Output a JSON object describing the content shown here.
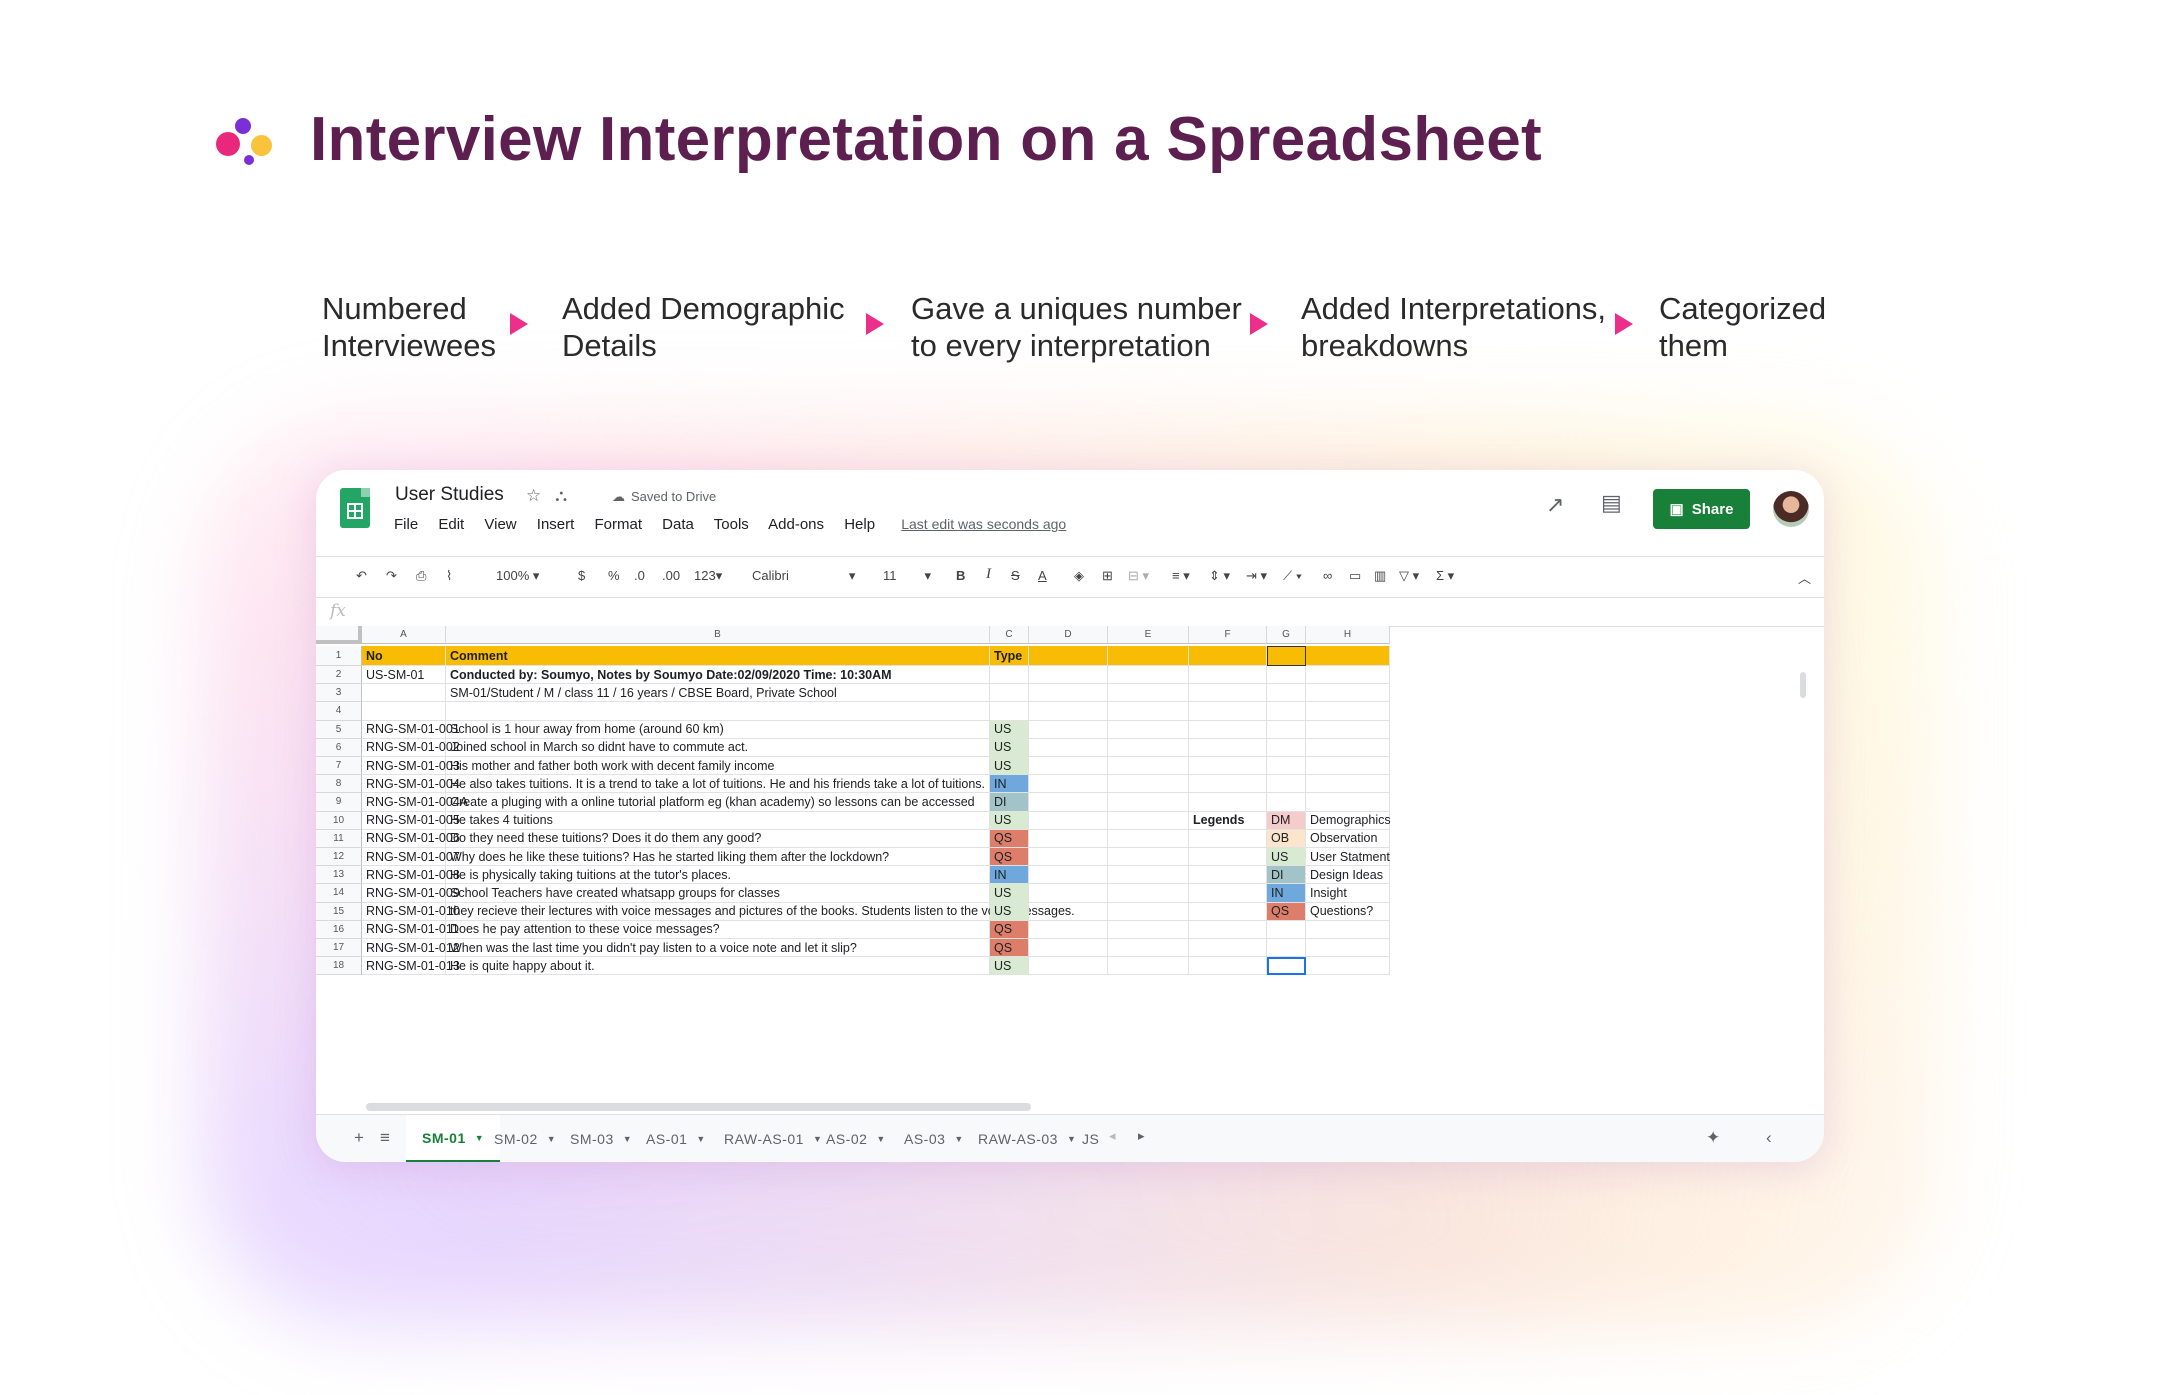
{
  "page": {
    "title": "Interview Interpretation on a Spreadsheet",
    "steps": [
      {
        "line1": "Numbered",
        "line2": "Interviewees"
      },
      {
        "line1": "Added Demographic",
        "line2": "Details"
      },
      {
        "line1": "Gave a uniques number",
        "line2": "to every interpretation"
      },
      {
        "line1": "Added Interpretations,",
        "line2": "breakdowns"
      },
      {
        "line1": "Categorized",
        "line2": "them"
      }
    ]
  },
  "app": {
    "doc_title": "User Studies",
    "saved_status": "Saved to Drive",
    "menus": [
      "File",
      "Edit",
      "View",
      "Insert",
      "Format",
      "Data",
      "Tools",
      "Add-ons",
      "Help"
    ],
    "last_edit": "Last edit was seconds ago",
    "share_label": "Share",
    "toolbar": {
      "zoom": "100%",
      "currency": "$",
      "percent": "%",
      "dec_less": ".0",
      "dec_more": ".00",
      "format_num": "123",
      "font": "Calibri",
      "font_size": "11"
    },
    "formula_label": "fx"
  },
  "sheet": {
    "columns": [
      "A",
      "B",
      "C",
      "D",
      "E",
      "F",
      "G",
      "H"
    ],
    "rows": [
      {
        "n": "1",
        "A": "No",
        "B": "Comment",
        "C": "Type"
      },
      {
        "n": "2",
        "A": "US-SM-01",
        "B": "Conducted by: Soumyo, Notes by Soumyo Date:02/09/2020   Time: 10:30AM",
        "C": ""
      },
      {
        "n": "3",
        "A": "",
        "B": "SM-01/Student / M / class 11 / 16 years / CBSE Board, Private School",
        "C": ""
      },
      {
        "n": "4",
        "A": "",
        "B": "",
        "C": ""
      },
      {
        "n": "5",
        "A": "RNG-SM-01-001",
        "B": "School is 1 hour away from home (around 60 km)",
        "C": "US"
      },
      {
        "n": "6",
        "A": "RNG-SM-01-002",
        "B": "Joined school in March so didnt have to commute act.",
        "C": "US"
      },
      {
        "n": "7",
        "A": "RNG-SM-01-003",
        "B": "His mother and father both work with decent family income",
        "C": "US"
      },
      {
        "n": "8",
        "A": "RNG-SM-01-004",
        "B": "He also takes tuitions. It is a trend to take a lot of tuitions. He and his friends take a lot of tuitions.",
        "C": "IN"
      },
      {
        "n": "9",
        "A": "RNG-SM-01-004A",
        "B": "Create a pluging with a online tutorial platform eg (khan academy) so lessons can be accessed",
        "C": "DI"
      },
      {
        "n": "10",
        "A": "RNG-SM-01-005",
        "B": "He takes 4 tuitions",
        "C": "US"
      },
      {
        "n": "11",
        "A": "RNG-SM-01-006",
        "B": "Do they need these tuitions? Does it do them any good?",
        "C": "QS"
      },
      {
        "n": "12",
        "A": "RNG-SM-01-007",
        "B": "Why does he like these tuitions? Has he started liking them after the lockdown?",
        "C": "QS"
      },
      {
        "n": "13",
        "A": "RNG-SM-01-008",
        "B": "He is physically taking tuitions at the tutor's places.",
        "C": "IN"
      },
      {
        "n": "14",
        "A": "RNG-SM-01-009",
        "B": "School Teachers have created whatsapp groups for classes",
        "C": "US"
      },
      {
        "n": "15",
        "A": "RNG-SM-01-010",
        "B": "they recieve their lectures with voice messages and pictures of the books. Students listen to the voice messages.",
        "C": "US"
      },
      {
        "n": "16",
        "A": "RNG-SM-01-011",
        "B": "Does he pay attention to these voice messages?",
        "C": "QS"
      },
      {
        "n": "17",
        "A": "RNG-SM-01-012",
        "B": "When was the last time you didn't pay listen to a voice note and let it slip?",
        "C": "QS"
      },
      {
        "n": "18",
        "A": "RNG-SM-01-013",
        "B": "He is quite happy about it.",
        "C": "US"
      }
    ],
    "legend_title": "Legends",
    "legends": [
      {
        "code": "DM",
        "label": "Demographics"
      },
      {
        "code": "OB",
        "label": "Observation"
      },
      {
        "code": "US",
        "label": "User Statment"
      },
      {
        "code": "DI",
        "label": "Design Ideas"
      },
      {
        "code": "IN",
        "label": "Insight"
      },
      {
        "code": "QS",
        "label": "Questions?"
      }
    ],
    "type_colors": {
      "US": "#d9ead3",
      "IN": "#6fa8dc",
      "DI": "#a2c4c9",
      "QS": "#dd7e6b",
      "DM": "#f4cccc",
      "OB": "#fce5cd"
    },
    "header_color": "#f9bc04"
  },
  "tabs": [
    {
      "label": "SM-01",
      "active": true
    },
    {
      "label": "SM-02",
      "active": false
    },
    {
      "label": "SM-03",
      "active": false
    },
    {
      "label": "AS-01",
      "active": false
    },
    {
      "label": "RAW-AS-01",
      "active": false
    },
    {
      "label": "AS-02",
      "active": false
    },
    {
      "label": "AS-03",
      "active": false
    },
    {
      "label": "RAW-AS-03",
      "active": false
    },
    {
      "label": "JS",
      "active": false
    }
  ],
  "colors": {
    "title": "#5d1f4f",
    "arrow": "#ec2f8b",
    "share": "#188038"
  }
}
